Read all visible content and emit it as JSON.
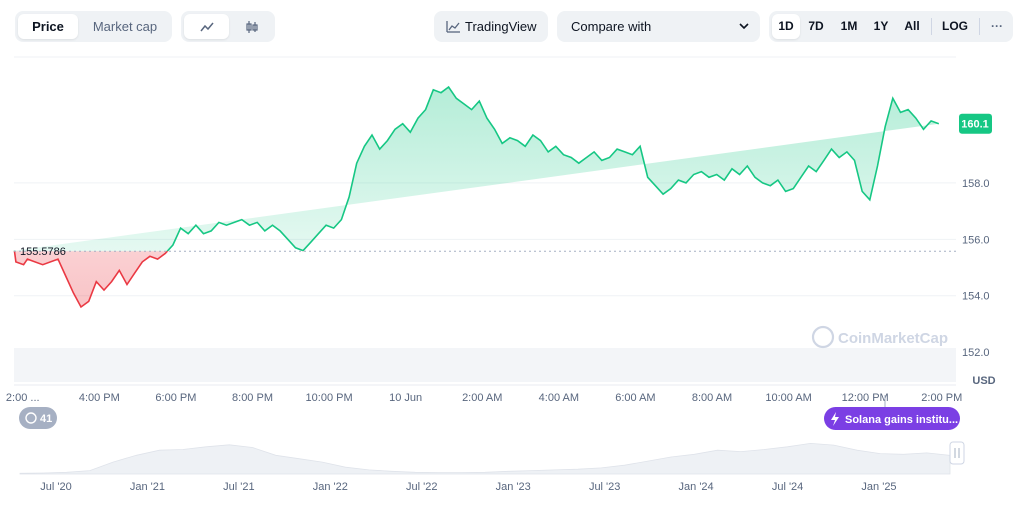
{
  "toolbar": {
    "price_tab": "Price",
    "market_cap_tab": "Market cap",
    "line_icon": "line-chart-icon",
    "candle_icon": "candlestick-icon",
    "tradingview_label": "TradingView",
    "tradingview_icon": "tradingview-icon",
    "compare_label": "Compare with",
    "compare_icon": "chevron-down-icon",
    "ranges": [
      "1D",
      "7D",
      "1M",
      "1Y",
      "All"
    ],
    "active_range": "1D",
    "log_label": "LOG",
    "more_label": "···"
  },
  "colors": {
    "up": "#16c784",
    "down": "#ea3943",
    "event": "#7b3fe4",
    "muted": "#58667e"
  },
  "chart_data": {
    "type": "area",
    "currency": "USD",
    "reference_value": 155.5786,
    "reference_label": "155.5786",
    "current_value": 160.1,
    "current_label": "160.1",
    "ylim": [
      150.8,
      162.5
    ],
    "yticks": [
      152.0,
      154.0,
      156.0,
      158.0
    ],
    "ytick_labels": [
      "152.0",
      "154.0",
      "156.0",
      "158.0"
    ],
    "yaxis_unit": "USD",
    "xlim": [
      13.85,
      38.45
    ],
    "xticks": [
      14.0,
      16.0,
      18.0,
      20.0,
      22.0,
      24.0,
      26.0,
      28.0,
      30.0,
      32.0,
      34.0,
      36.0,
      38.0
    ],
    "xtick_labels": [
      "2:00 ...",
      "4:00 PM",
      "6:00 PM",
      "8:00 PM",
      "10:00 PM",
      "10 Jun",
      "2:00 AM",
      "4:00 AM",
      "6:00 AM",
      "8:00 AM",
      "10:00 AM",
      "12:00 PM",
      "2:00 PM"
    ],
    "x": [
      13.86,
      13.9,
      14.1,
      14.2,
      14.6,
      15.0,
      15.2,
      15.4,
      15.6,
      15.8,
      16.0,
      16.2,
      16.4,
      16.6,
      16.8,
      17.0,
      17.2,
      17.4,
      17.6,
      17.8,
      18.0,
      18.2,
      18.4,
      18.6,
      18.8,
      19.0,
      19.2,
      19.4,
      19.6,
      19.8,
      20.0,
      20.2,
      20.4,
      20.6,
      20.8,
      21.0,
      21.2,
      21.4,
      21.6,
      21.8,
      22.0,
      22.2,
      22.4,
      22.6,
      22.8,
      23.0,
      23.2,
      23.4,
      23.6,
      23.8,
      24.0,
      24.2,
      24.4,
      24.6,
      24.8,
      25.0,
      25.2,
      25.4,
      25.6,
      25.8,
      26.0,
      26.2,
      26.4,
      26.6,
      26.8,
      27.0,
      27.2,
      27.4,
      27.6,
      27.8,
      28.0,
      28.2,
      28.4,
      28.6,
      28.8,
      29.0,
      29.2,
      29.4,
      29.6,
      29.8,
      30.0,
      30.2,
      30.4,
      30.6,
      30.8,
      31.0,
      31.2,
      31.4,
      31.6,
      31.8,
      32.0,
      32.2,
      32.4,
      32.6,
      32.8,
      33.0,
      33.2,
      33.4,
      33.6,
      33.8,
      34.0,
      34.2,
      34.4,
      34.6,
      34.8,
      35.0,
      35.2,
      35.4,
      35.6,
      35.8,
      36.0,
      36.2,
      36.4,
      36.6,
      36.8,
      37.0,
      37.2,
      37.4,
      37.6,
      37.8,
      38.0,
      38.2,
      38.4
    ],
    "y": [
      155.6,
      155.2,
      155.1,
      155.3,
      155.1,
      155.3,
      154.7,
      154.1,
      153.6,
      153.8,
      154.5,
      154.2,
      154.5,
      154.9,
      154.4,
      154.8,
      155.2,
      155.4,
      155.3,
      155.5,
      155.8,
      156.4,
      156.2,
      156.5,
      156.2,
      156.3,
      156.6,
      156.5,
      156.6,
      156.7,
      156.5,
      156.6,
      156.3,
      156.5,
      156.3,
      156.0,
      155.7,
      155.6,
      155.9,
      156.2,
      156.5,
      156.4,
      156.7,
      157.5,
      158.7,
      159.3,
      159.7,
      159.2,
      159.5,
      159.9,
      160.1,
      159.8,
      160.3,
      160.6,
      161.3,
      161.2,
      161.4,
      161.0,
      160.8,
      160.6,
      160.9,
      160.3,
      159.9,
      159.4,
      159.6,
      159.5,
      159.3,
      159.7,
      159.5,
      159.1,
      159.3,
      159.0,
      158.9,
      158.7,
      158.9,
      159.1,
      158.8,
      158.9,
      159.2,
      159.1,
      159.0,
      159.3,
      158.2,
      157.9,
      157.6,
      157.8,
      158.1,
      158.0,
      158.3,
      158.4,
      158.2,
      158.3,
      158.1,
      158.5,
      158.3,
      158.6,
      158.2,
      158.0,
      157.9,
      158.1,
      157.7,
      157.8,
      158.2,
      158.6,
      158.4,
      158.8,
      159.2,
      158.9,
      159.1,
      158.8,
      157.7,
      157.4,
      158.6,
      160.0,
      161.0,
      160.5,
      160.6,
      160.3,
      159.9,
      160.2,
      160.1
    ]
  },
  "annotations": {
    "counter_label": "41",
    "counter_icon": "history-icon",
    "event_label": "Solana gains institu...",
    "event_icon": "lightning-icon",
    "watermark": "CoinMarketCap",
    "watermark_icon": "coinmarketcap-logo-icon"
  },
  "navigator": {
    "labels": [
      "Jul '20",
      "Jan '21",
      "Jul '21",
      "Jan '22",
      "Jul '22",
      "Jan '23",
      "Jul '23",
      "Jan '24",
      "Jul '24",
      "Jan '25"
    ],
    "history": [
      0.02,
      0.03,
      0.05,
      0.1,
      0.35,
      0.55,
      0.7,
      0.72,
      0.8,
      0.86,
      0.78,
      0.55,
      0.45,
      0.35,
      0.2,
      0.12,
      0.08,
      0.05,
      0.04,
      0.04,
      0.05,
      0.08,
      0.1,
      0.12,
      0.14,
      0.18,
      0.26,
      0.38,
      0.5,
      0.58,
      0.7,
      0.66,
      0.72,
      0.8,
      0.9,
      0.85,
      0.7,
      0.6,
      0.58,
      0.62,
      0.55
    ],
    "handle_icon": "range-handle-icon"
  }
}
